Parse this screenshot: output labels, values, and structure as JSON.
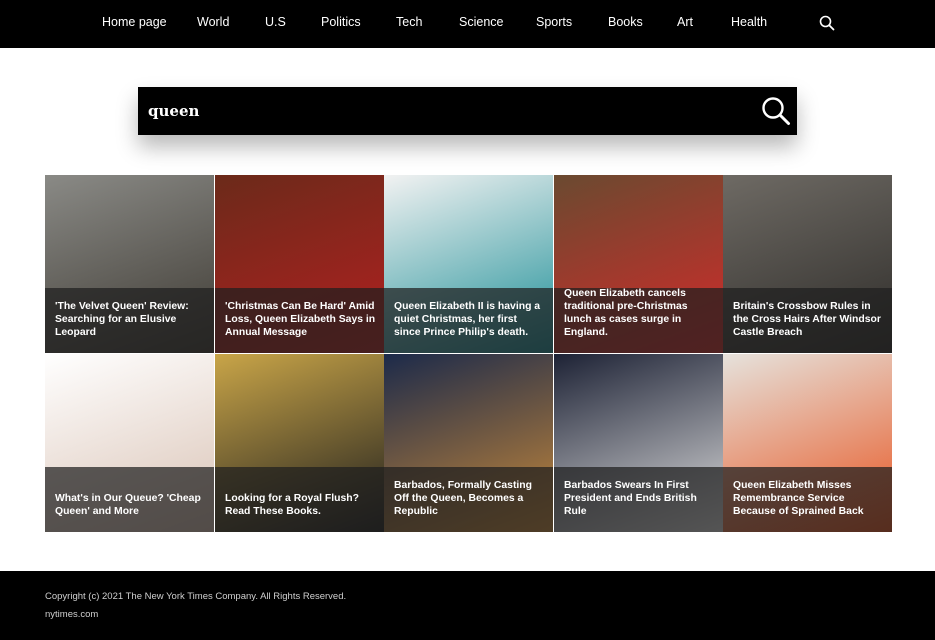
{
  "nav": {
    "items": [
      "Home page",
      "World",
      "U.S",
      "Politics",
      "Tech",
      "Science",
      "Sports",
      "Books",
      "Art",
      "Health"
    ],
    "search_icon": "search-icon"
  },
  "search": {
    "value": "queen",
    "button_icon": "search-icon"
  },
  "articles": [
    {
      "title": "'The Velvet Queen' Review: Searching for an Elusive Leopard",
      "thumb_colors": [
        "#8a8a86",
        "#3e3a33"
      ]
    },
    {
      "title": "'Christmas Can Be Hard' Amid Loss, Queen Elizabeth Says in Annual Message",
      "thumb_colors": [
        "#6b2a1a",
        "#b32020"
      ]
    },
    {
      "title": "Queen Elizabeth II is having a quiet Christmas, her first since Prince Philip's death.",
      "thumb_colors": [
        "#f2f2f2",
        "#1a8e96"
      ]
    },
    {
      "title": "Queen Elizabeth cancels traditional pre-Christmas lunch as cases surge in England.",
      "thumb_colors": [
        "#6a4a30",
        "#d42a2a"
      ]
    },
    {
      "title": "Britain's Crossbow Rules in the Cross Hairs After Windsor Castle Breach",
      "thumb_colors": [
        "#6e6a64",
        "#2e2c29"
      ]
    },
    {
      "title": "What's in Our Queue? 'Cheap Queen' and More",
      "thumb_colors": [
        "#ffffff",
        "#d9c2b4"
      ]
    },
    {
      "title": "Looking for a Royal Flush? Read These Books.",
      "thumb_colors": [
        "#c9a548",
        "#1d1d1d"
      ]
    },
    {
      "title": "Barbados, Formally Casting Off the Queen, Becomes a Republic",
      "thumb_colors": [
        "#1c2a4a",
        "#c98a3a"
      ]
    },
    {
      "title": "Barbados Swears In First President and Ends British Rule",
      "thumb_colors": [
        "#1d2235",
        "#e0e0e0"
      ]
    },
    {
      "title": "Queen Elizabeth Misses Remembrance Service Because of Sprained Back",
      "thumb_colors": [
        "#e6e2dc",
        "#e8531e"
      ]
    }
  ],
  "footer": {
    "copyright": "Copyright (c) 2021 The New York Times Company. All Rights Reserved.",
    "link": "nytimes.com"
  }
}
